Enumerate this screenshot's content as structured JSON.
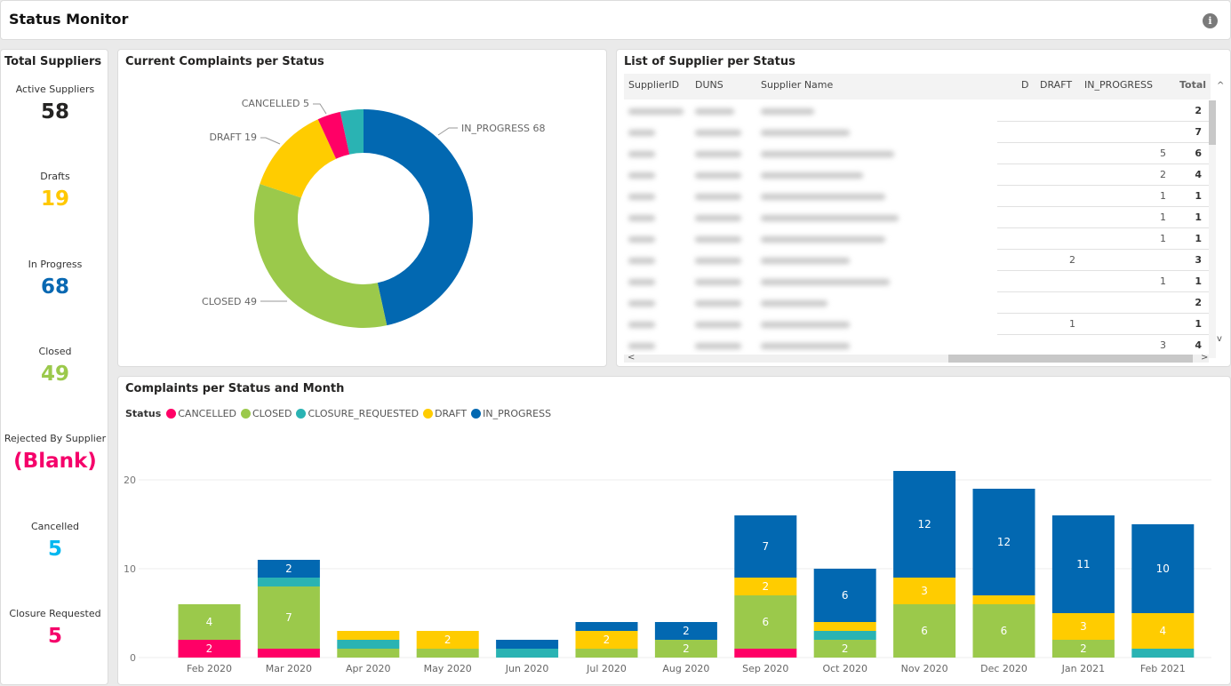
{
  "header": {
    "title": "Status Monitor",
    "info_icon": "info-icon"
  },
  "sidebar": {
    "title": "Total Suppliers",
    "kpis": [
      {
        "label": "Active Suppliers",
        "value": "58",
        "color": "#252423"
      },
      {
        "label": "Drafts",
        "value": "19",
        "color": "#FFC800"
      },
      {
        "label": "In Progress",
        "value": "68",
        "color": "#0868B2"
      },
      {
        "label": "Closed",
        "value": "49",
        "color": "#9BC94B"
      },
      {
        "label": "Rejected By Supplier",
        "value": "(Blank)",
        "color": "#F5006A"
      },
      {
        "label": "Cancelled",
        "value": "5",
        "color": "#00B7F0"
      },
      {
        "label": "Closure Requested",
        "value": "5",
        "color": "#F5006A"
      }
    ]
  },
  "colors": {
    "CANCELLED": "#FF0066",
    "CLOSED": "#9BC94B",
    "CLOSURE_REQUESTED": "#2AB3B3",
    "DRAFT": "#FFCC00",
    "IN_PROGRESS": "#0268B1"
  },
  "donut": {
    "title": "Current Complaints per Status",
    "slices": [
      {
        "name": "IN_PROGRESS",
        "value": 68,
        "label": "IN_PROGRESS 68"
      },
      {
        "name": "CLOSED",
        "value": 49,
        "label": "CLOSED 49"
      },
      {
        "name": "DRAFT",
        "value": 19,
        "label": "DRAFT 19"
      },
      {
        "name": "CANCELLED",
        "value": 5,
        "label": "CANCELLED 5"
      },
      {
        "name": "CLOSURE_REQUESTED",
        "value": 5,
        "label": ""
      }
    ]
  },
  "table": {
    "title": "List of Supplier per Status",
    "columns": [
      "SupplierID",
      "DUNS",
      "Supplier Name",
      "D",
      "DRAFT",
      "IN_PROGRESS",
      "Total"
    ],
    "rows": [
      {
        "draft": "",
        "in_progress": "",
        "total": "2"
      },
      {
        "draft": "",
        "in_progress": "",
        "total": "7"
      },
      {
        "draft": "",
        "in_progress": "5",
        "total": "6"
      },
      {
        "draft": "",
        "in_progress": "2",
        "total": "4"
      },
      {
        "draft": "",
        "in_progress": "1",
        "total": "1"
      },
      {
        "draft": "",
        "in_progress": "1",
        "total": "1"
      },
      {
        "draft": "",
        "in_progress": "1",
        "total": "1"
      },
      {
        "draft": "2",
        "in_progress": "",
        "total": "3"
      },
      {
        "draft": "",
        "in_progress": "1",
        "total": "1"
      },
      {
        "draft": "",
        "in_progress": "",
        "total": "2"
      },
      {
        "draft": "1",
        "in_progress": "",
        "total": "1"
      },
      {
        "draft": "",
        "in_progress": "3",
        "total": "4"
      }
    ],
    "scroll_up": "^",
    "scroll_down": "v",
    "scroll_left": "<",
    "scroll_right": ">"
  },
  "chart_data": {
    "type": "bar",
    "stacked": true,
    "title": "Complaints per Status and Month",
    "legend_title": "Status",
    "legend_position": "top-left",
    "categories": [
      "Feb 2020",
      "Mar 2020",
      "Apr 2020",
      "May 2020",
      "Jun 2020",
      "Jul 2020",
      "Aug 2020",
      "Sep 2020",
      "Oct 2020",
      "Nov 2020",
      "Dec 2020",
      "Jan 2021",
      "Feb 2021"
    ],
    "series": [
      {
        "name": "CANCELLED",
        "values": [
          2,
          1,
          0,
          0,
          0,
          0,
          0,
          1,
          0,
          0,
          0,
          0,
          0
        ]
      },
      {
        "name": "CLOSED",
        "values": [
          4,
          7,
          1,
          1,
          0,
          1,
          2,
          6,
          2,
          6,
          6,
          2,
          0
        ]
      },
      {
        "name": "CLOSURE_REQUESTED",
        "values": [
          0,
          1,
          1,
          0,
          1,
          0,
          0,
          0,
          1,
          0,
          0,
          0,
          1
        ]
      },
      {
        "name": "DRAFT",
        "values": [
          0,
          0,
          1,
          2,
          0,
          2,
          0,
          2,
          1,
          3,
          1,
          3,
          4
        ]
      },
      {
        "name": "IN_PROGRESS",
        "values": [
          0,
          2,
          0,
          0,
          1,
          1,
          2,
          7,
          6,
          12,
          12,
          11,
          10
        ]
      }
    ],
    "yticks": [
      0,
      10,
      20
    ],
    "ylim": [
      0,
      22
    ],
    "grid": true,
    "xlabel": "",
    "ylabel": ""
  }
}
